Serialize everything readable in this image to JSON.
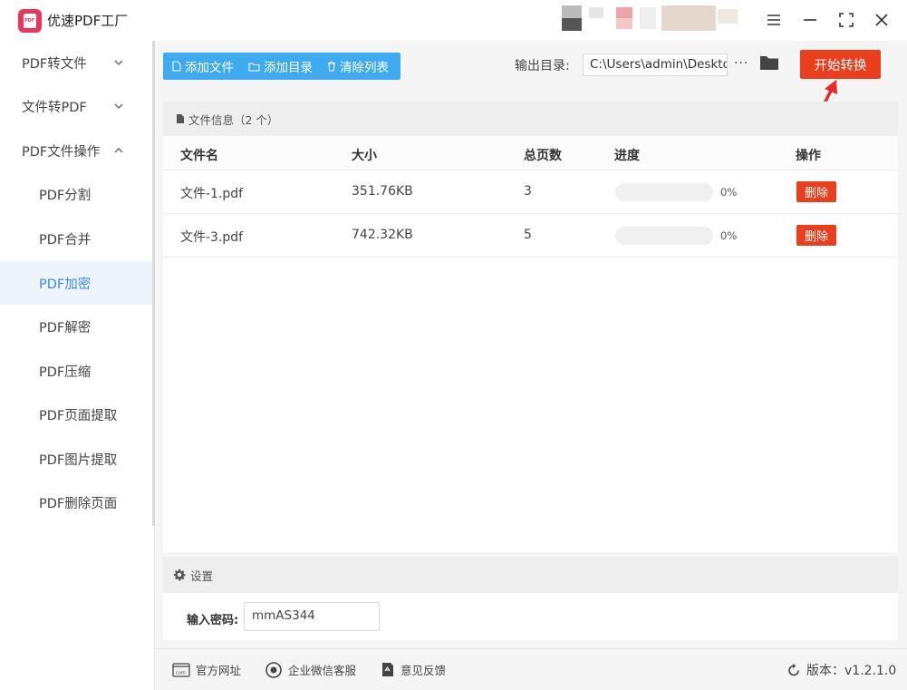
{
  "app": {
    "title": "优速PDF工厂",
    "logo_text": "PDF"
  },
  "window": {
    "menu": "menu-icon",
    "minimize": "minimize-icon",
    "maximize": "maximize-icon",
    "close": "close-icon"
  },
  "sidebar": {
    "groups": [
      {
        "label": "PDF转文件",
        "expanded": false
      },
      {
        "label": "文件转PDF",
        "expanded": false
      },
      {
        "label": "PDF文件操作",
        "expanded": true
      }
    ],
    "subitems": [
      {
        "label": "PDF分割",
        "active": false
      },
      {
        "label": "PDF合并",
        "active": false
      },
      {
        "label": "PDF加密",
        "active": true
      },
      {
        "label": "PDF解密",
        "active": false
      },
      {
        "label": "PDF压缩",
        "active": false
      },
      {
        "label": "PDF页面提取",
        "active": false
      },
      {
        "label": "PDF图片提取",
        "active": false
      },
      {
        "label": "PDF删除页面",
        "active": false
      }
    ]
  },
  "toolbar": {
    "add_file": "添加文件",
    "add_dir": "添加目录",
    "clear_list": "清除列表",
    "output_label": "输出目录:",
    "output_path": "C:\\Users\\admin\\Deskto",
    "more": "···",
    "start": "开始转换"
  },
  "file_panel": {
    "title": "文件信息（2 个）",
    "columns": [
      "文件名",
      "大小",
      "总页数",
      "进度",
      "操作"
    ],
    "rows": [
      {
        "name": "文件-1.pdf",
        "size": "351.76KB",
        "pages": "3",
        "progress": 0,
        "progress_text": "0%",
        "action": "删除"
      },
      {
        "name": "文件-3.pdf",
        "size": "742.32KB",
        "pages": "5",
        "progress": 0,
        "progress_text": "0%",
        "action": "删除"
      }
    ]
  },
  "settings": {
    "title": "设置",
    "password_label": "输入密码:",
    "password_value": "mmAS344"
  },
  "footer": {
    "website": "官方网址",
    "wechat": "企业微信客服",
    "feedback": "意见反馈",
    "version": "版本：v1.2.1.0"
  },
  "colors": {
    "accent": "#3eaaf0",
    "danger": "#ea3e1c",
    "active_text": "#3d8ae6",
    "logo": "#e8385a"
  }
}
